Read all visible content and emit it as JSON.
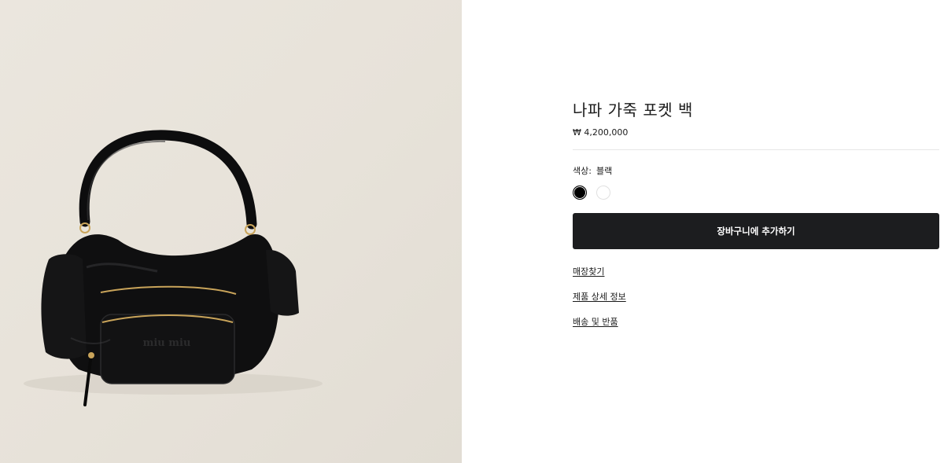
{
  "product": {
    "title": "나파 가죽 포켓 백",
    "price": "₩ 4,200,000",
    "color_label": "색상:",
    "color_value": "블랙",
    "swatches": [
      {
        "name": "black",
        "color": "#000000"
      },
      {
        "name": "white",
        "color": "#ffffff"
      }
    ],
    "add_to_cart_label": "장바구니에 추가하기",
    "links": [
      "매장찾기",
      "제품 상세 정보",
      "배송 및 반품"
    ]
  },
  "image": {
    "logo_text": "miu miu",
    "background": "#e9e4dc",
    "bag_color": "#0f0f10",
    "hardware_color": "#c9a45a"
  }
}
